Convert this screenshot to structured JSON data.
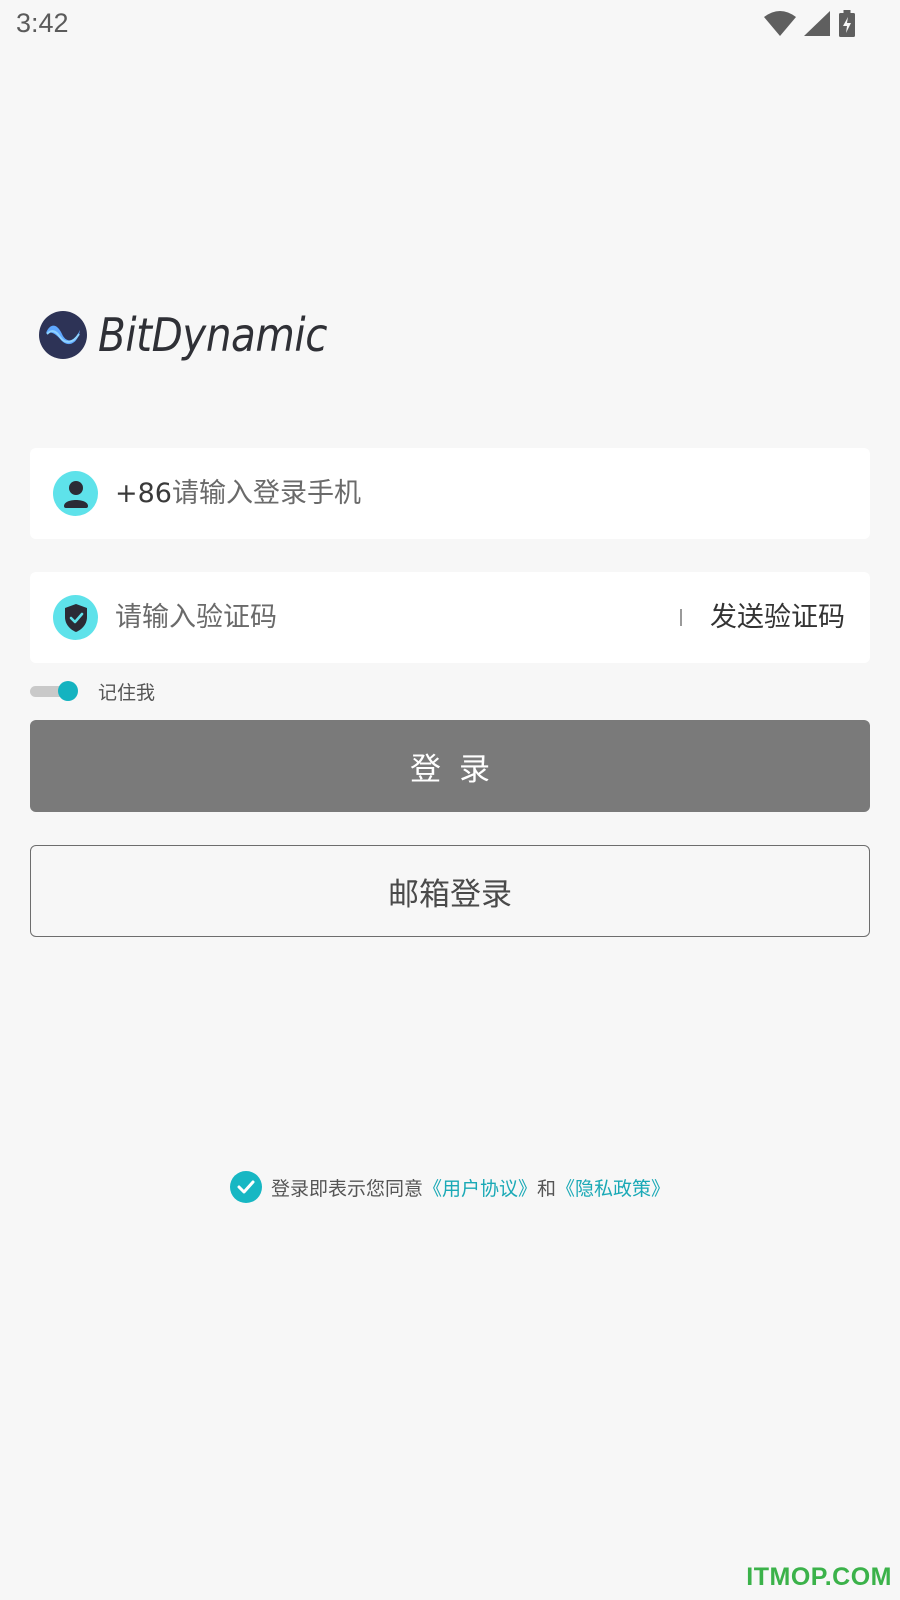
{
  "status_bar": {
    "time": "3:42",
    "icons": [
      "wifi-icon",
      "cell-signal-icon",
      "battery-charging-icon"
    ]
  },
  "brand": {
    "name": "BitDynamic",
    "logo_icon": "wave-logo-icon",
    "logo_color": "#2d3356",
    "logo_accent": "#5fa8ff"
  },
  "phone_field": {
    "icon": "user-icon",
    "prefix": "+86",
    "placeholder": "请输入登录手机",
    "value": ""
  },
  "code_field": {
    "icon": "shield-check-icon",
    "placeholder": "请输入验证码",
    "value": "",
    "send_label": "发送验证码"
  },
  "remember": {
    "label": "记住我",
    "on": true
  },
  "buttons": {
    "login": "登录",
    "email_login": "邮箱登录"
  },
  "agreement": {
    "checked": true,
    "text": "登录即表示您同意",
    "user_agreement": "《用户协议》",
    "and": "和",
    "privacy_policy": "《隐私政策》"
  },
  "watermark": "ITMOP.COM",
  "colors": {
    "accent": "#17b7c3",
    "icon_bg": "#5ee2ea",
    "login_button": "#7a7a7a",
    "link": "#1aa9b6",
    "watermark": "#3bb24a"
  }
}
